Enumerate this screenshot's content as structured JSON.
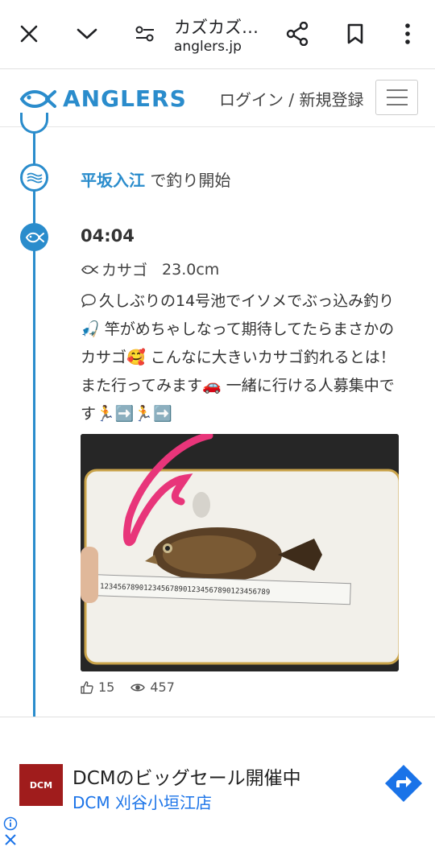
{
  "browser": {
    "tab_title": "カズカズ…",
    "url": "anglers.jp"
  },
  "header": {
    "logo_text": "ANGLERS",
    "login_link": "ログイン / 新規登録"
  },
  "timeline": {
    "start": {
      "place_name": "平坂入江",
      "place_suffix": " で釣り開始"
    },
    "entry": {
      "time": "04:04",
      "species": "カサゴ",
      "size": "23.0cm",
      "comment": "久しぶりの14号池でイソメでぶっ込み釣り🎣 竿がめちゃしなって期待してたらまさかのカサゴ🥰 こんなに大きいカサゴ釣れるとは！また行ってみます🚗 一緒に行ける人募集中です🏃➡️🏃➡️",
      "likes": "15",
      "views": "457"
    }
  },
  "ad": {
    "logo_text": "DCM",
    "title": "DCMのビッグセール開催中",
    "subtitle": "DCM 刈谷小垣江店"
  },
  "colors": {
    "brand": "#2a8ccc",
    "ad_link": "#1a73e8",
    "ad_logo_bg": "#a01c1c"
  }
}
